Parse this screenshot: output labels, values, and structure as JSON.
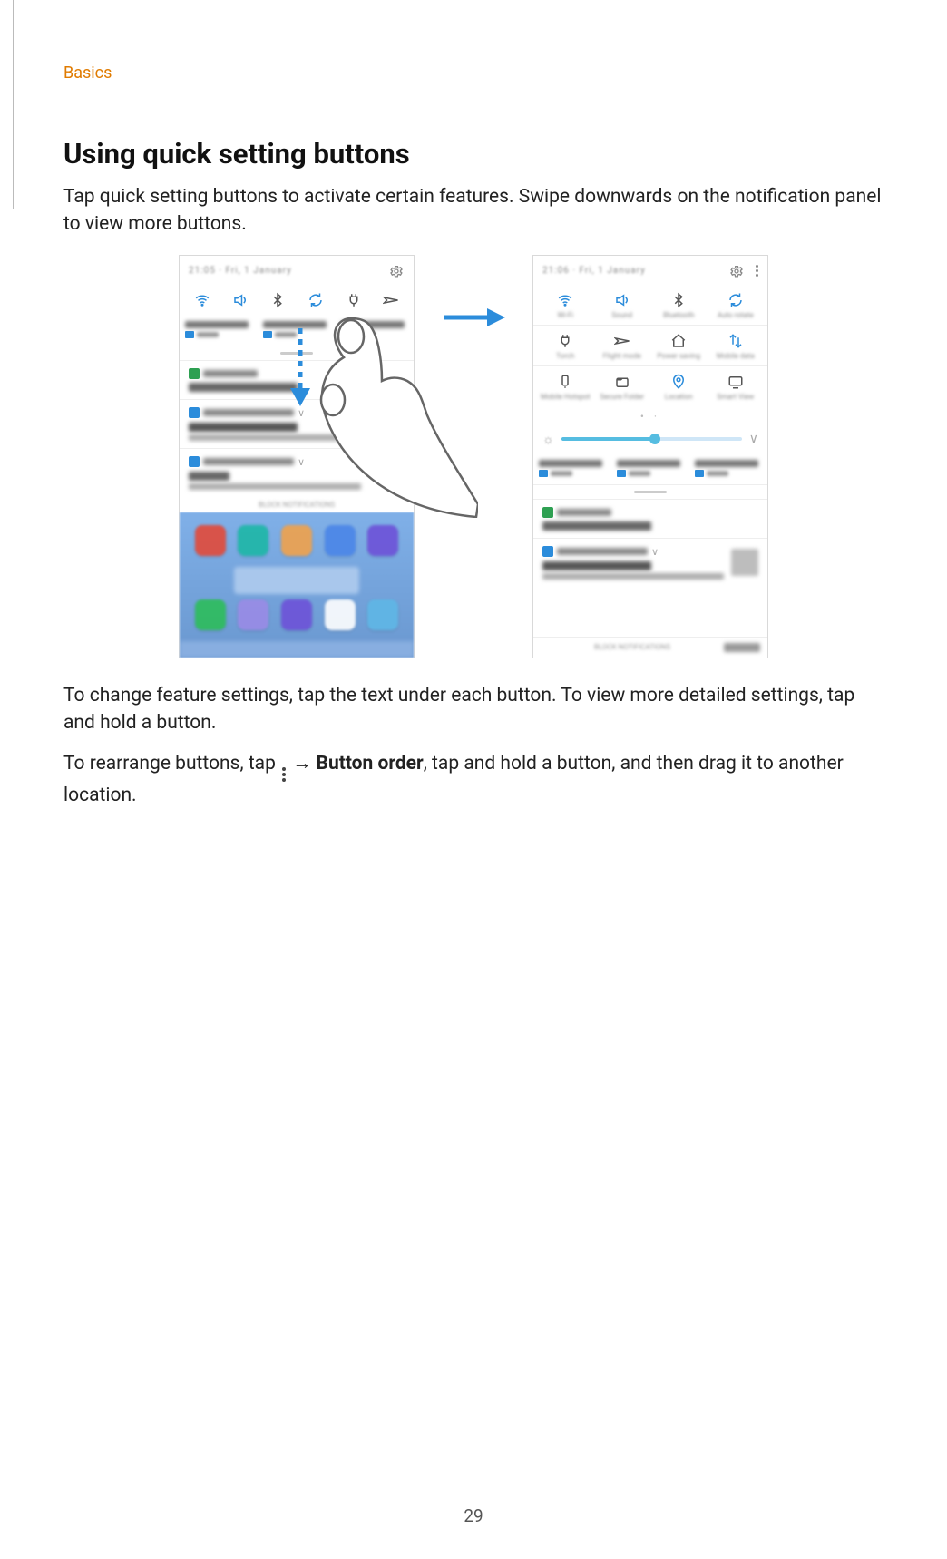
{
  "section_label": "Basics",
  "title": "Using quick setting buttons",
  "intro_paragraph": "Tap quick setting buttons to activate certain features. Swipe downwards on the notification panel to view more buttons.",
  "para2": "To change feature settings, tap the text under each button. To view more detailed settings, tap and hold a button.",
  "para3_before_icon": "To rearrange buttons, tap ",
  "para3_arrow": " → ",
  "para3_button_order": "Button order",
  "para3_after": ", tap and hold a button, and then drag it to another location.",
  "page_number": "29",
  "figure": {
    "icons": {
      "gear": "settings-gear-icon",
      "more": "more-vertical-icon",
      "wifi": "wifi-icon",
      "sound": "sound-icon",
      "bluetooth": "bluetooth-icon",
      "autorotate": "autorotate-icon",
      "power": "power-plug-icon",
      "airplane": "airplane-icon",
      "torch": "torch-icon",
      "home": "home-icon",
      "updown": "sync-arrows-icon",
      "hotspot": "mobile-hotspot-icon",
      "folder": "secure-folder-icon",
      "location": "location-pin-icon"
    }
  }
}
